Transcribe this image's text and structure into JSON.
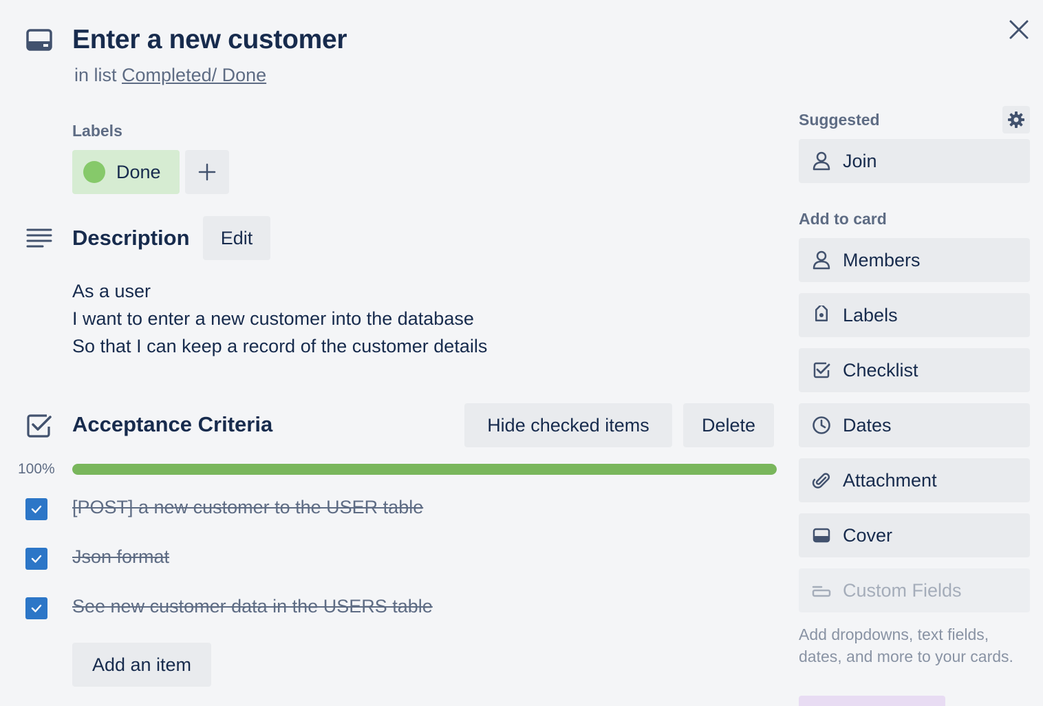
{
  "card": {
    "title": "Enter a new customer",
    "in_list_prefix": "in list",
    "list_name": "Completed/ Done"
  },
  "labels": {
    "heading": "Labels",
    "items": [
      {
        "text": "Done",
        "color": "#86c96a",
        "bg": "#d6ecd2"
      }
    ]
  },
  "description": {
    "heading": "Description",
    "edit_label": "Edit",
    "lines": [
      "As a user",
      "I want to enter a new customer into the database",
      "So that I can keep a record of the customer details"
    ]
  },
  "checklist": {
    "title": "Acceptance Criteria",
    "hide_label": "Hide checked items",
    "delete_label": "Delete",
    "progress_text": "100%",
    "progress": 1.0,
    "progress_color": "#79b65c",
    "items": [
      {
        "text": "[POST] a new customer to the USER table",
        "checked": true
      },
      {
        "text": "Json format",
        "checked": true
      },
      {
        "text": "See new customer data in the USERS table",
        "checked": true
      }
    ],
    "add_item_label": "Add an item"
  },
  "sidebar": {
    "suggested_heading": "Suggested",
    "join_label": "Join",
    "add_to_card_heading": "Add to card",
    "buttons": [
      {
        "label": "Members",
        "icon": "person-icon"
      },
      {
        "label": "Labels",
        "icon": "tag-icon"
      },
      {
        "label": "Checklist",
        "icon": "checklist-icon"
      },
      {
        "label": "Dates",
        "icon": "clock-icon"
      },
      {
        "label": "Attachment",
        "icon": "paperclip-icon"
      },
      {
        "label": "Cover",
        "icon": "cover-icon"
      },
      {
        "label": "Custom Fields",
        "icon": "custom-fields-icon",
        "disabled": true
      }
    ],
    "custom_fields_help": "Add dropdowns, text fields, dates, and more to your cards."
  },
  "colors": {
    "checkbox": "#2c76c7",
    "text_primary": "#172b4d",
    "text_secondary": "#5e6c84"
  }
}
